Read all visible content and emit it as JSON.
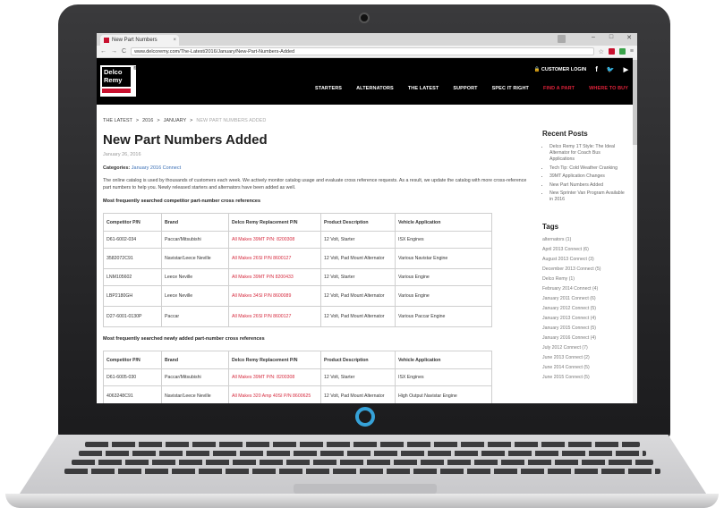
{
  "browser": {
    "tab_title": "New Part Numbers",
    "tab_close": "×",
    "url": "www.delcoremy.com/The-Latest/2016/January/New-Part-Numbers-Added",
    "win_minimize": "–",
    "win_maximize": "□",
    "win_close": "✕",
    "back": "←",
    "forward": "→",
    "reload": "C",
    "star": "☆",
    "menu": "≡"
  },
  "header": {
    "logo_line1": "Delco",
    "logo_line2": "Remy",
    "logo_reg": "®",
    "customer_login": "CUSTOMER LOGIN",
    "nav": [
      "STARTERS",
      "ALTERNATORS",
      "THE LATEST",
      "SUPPORT",
      "SPEC IT RIGHT",
      "FIND A PART",
      "WHERE TO BUY"
    ]
  },
  "breadcrumb": [
    "THE LATEST",
    ">",
    "2016",
    ">",
    "JANUARY",
    ">",
    "NEW PART NUMBERS ADDED"
  ],
  "article": {
    "title": "New Part Numbers Added",
    "date": "January 26, 2016",
    "categories_label": "Categories:",
    "category": "January 2016 Connect",
    "intro": "The online catalog is used by thousands of customers each week. We actively monitor catalog usage and evaluate cross reference requests. As a result, we update the catalog with more cross-reference part numbers to help you. Newly released starters and alternators have been added as well.",
    "section1_title": "Most frequently searched competitor part-number cross references",
    "section2_title": "Most frequently searched newly added part-number cross references"
  },
  "table": {
    "headers": [
      "Competitor P/N",
      "Brand",
      "Delco Remy Replacement P/N",
      "Product Description",
      "Vehicle Application"
    ],
    "rows1": [
      [
        "D61-6002-034",
        "Paccar/Mitsubishi",
        "All Makes 39MT P/N: 8200308",
        "12 Volt, Starter",
        "ISX Engines"
      ],
      [
        "3582072C91",
        "Navistar/Leece Neville",
        "All Makes 26SI P/N 8600127",
        "12 Volt, Pad Mount Alternator",
        "Various Navistar Engine"
      ],
      [
        "LNM105602",
        "Leece Neville",
        "All Makes 39MT P/N 8200433",
        "12 Volt, Starter",
        "Various Engine"
      ],
      [
        "LBP2180GH",
        "Leece Neville",
        "All Makes 34SI P/N 8600089",
        "12 Volt, Pad Mount Alternator",
        "Various Engine"
      ],
      [
        "D27-6001-0130P",
        "Paccar",
        "All Makes 26SI P/N 8600127",
        "12 Volt, Pad Mount Alternator",
        "Various Paccar Engine"
      ]
    ],
    "rows2": [
      [
        "D61-6005-030",
        "Paccar/Mitsubishi",
        "All Makes 39MT P/N: 8200308",
        "12 Volt, Starter",
        "ISX Engines"
      ],
      [
        "4063248C91",
        "Navistar/Leece Neville",
        "All Makes 320 Amp 40SI P/N 8600625",
        "12 Volt, Pad Mount Alternator",
        "High Output Navistar Engine"
      ]
    ]
  },
  "sidebar": {
    "recent_title": "Recent Posts",
    "recent": [
      "Delco Remy 1T Style: The Ideal Alternator for Coach Bus Applications",
      "Tech Tip: Cold Weather Cranking",
      "39MT Application Changes",
      "New Part Numbers Added",
      "New Sprinter Van Program Available in 2016"
    ],
    "tags_title": "Tags",
    "tags": [
      "alternators (1)",
      "April 2013 Connect (6)",
      "August 2013 Connect (3)",
      "December 2013 Connect (5)",
      "Delco Remy (1)",
      "February 2014 Connect (4)",
      "January 2011 Connect (6)",
      "January 2012 Connect (5)",
      "January 2013 Connect (4)",
      "January 2015 Connect (5)",
      "January 2016 Connect (4)",
      "July 2012 Connect (7)",
      "June 2013 Connect (2)",
      "June 2014 Connect (5)",
      "June 2015 Connect (5)"
    ]
  },
  "colors": {
    "brand_red": "#c8102e",
    "header_black": "#000000",
    "link_red": "#d62b3f"
  }
}
